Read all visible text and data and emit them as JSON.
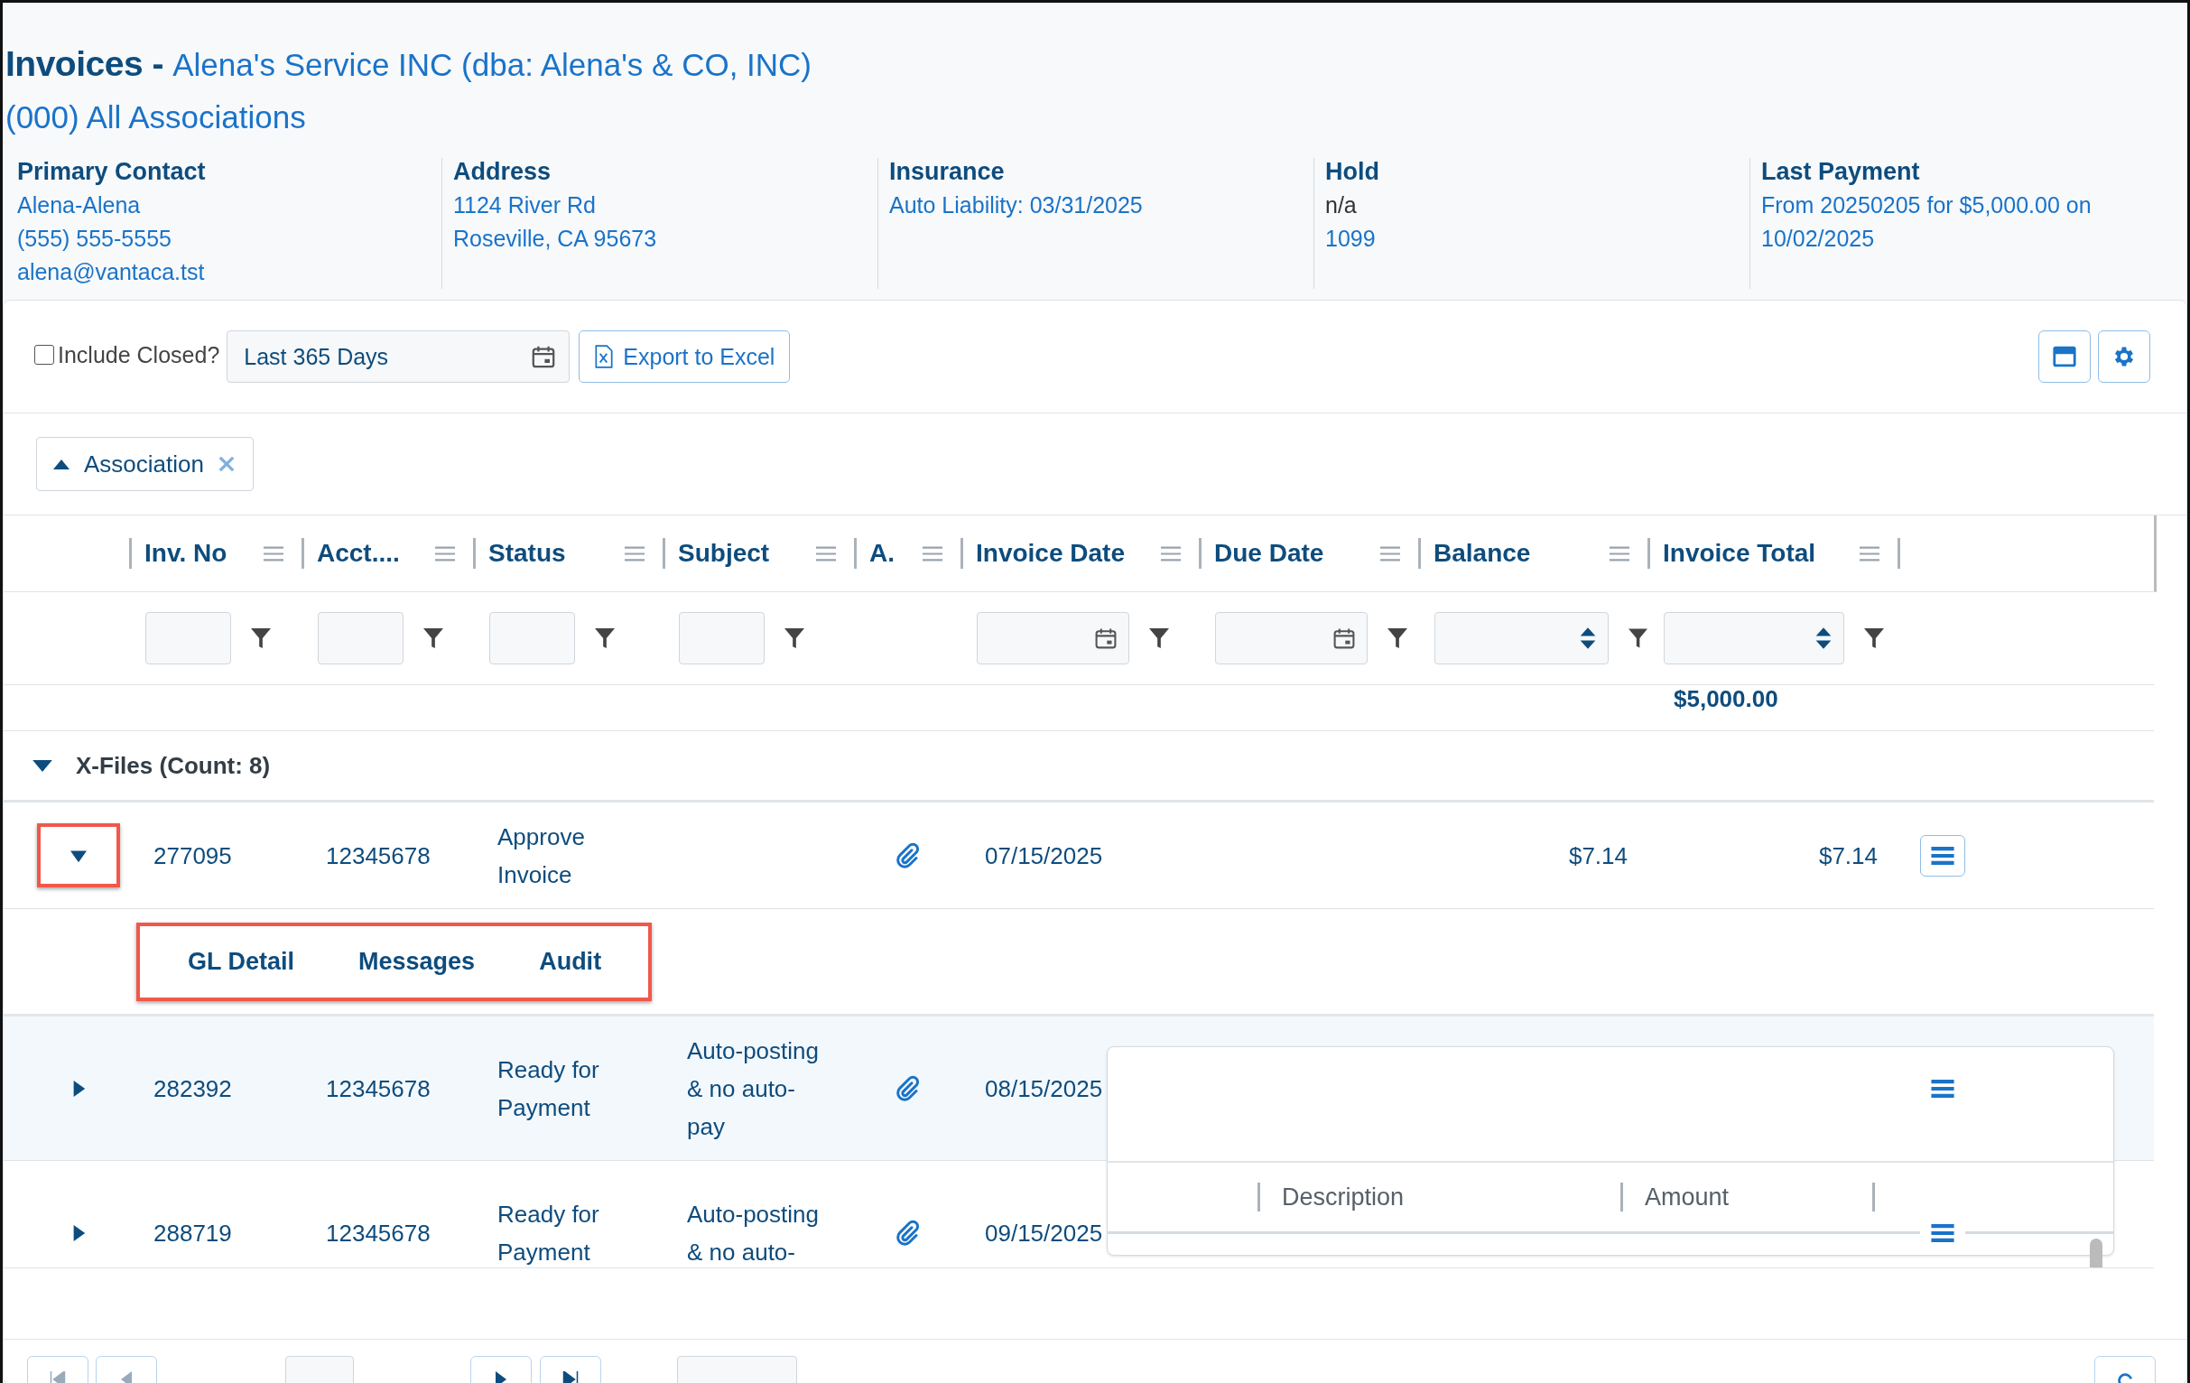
{
  "page": {
    "title": "Invoices - ",
    "vendor": "Alena's Service INC (dba: Alena's & CO, INC)",
    "association": "(000) All Associations"
  },
  "info": [
    {
      "label": "Primary Contact",
      "lines": [
        {
          "text": "Alena-Alena",
          "link": true
        },
        {
          "text": "(555) 555-5555",
          "link": true
        },
        {
          "text": "alena@vantaca.tst",
          "link": true
        }
      ]
    },
    {
      "label": "Address",
      "lines": [
        {
          "text": "1124 River Rd",
          "link": true
        },
        {
          "text": "Roseville, CA 95673",
          "link": true
        }
      ]
    },
    {
      "label": "Insurance",
      "lines": [
        {
          "text": "Auto Liability: 03/31/2025",
          "link": true
        }
      ]
    },
    {
      "label": "Hold",
      "lines": [
        {
          "text": "n/a",
          "link": false
        },
        {
          "text": "1099",
          "link": true
        }
      ]
    },
    {
      "label": "Last Payment",
      "lines": [
        {
          "text": "From 20250205 for $5,000.00 on 10/02/2025",
          "link": true
        }
      ]
    }
  ],
  "toolbar": {
    "include_closed": {
      "label": "Include Closed?",
      "checked": false
    },
    "date_range": "Last 365 Days",
    "export": "Export to Excel"
  },
  "group_chips": [
    {
      "label": "Association"
    }
  ],
  "columns": [
    {
      "label": "Inv. No",
      "kind": "text"
    },
    {
      "label": "Acct....",
      "kind": "text"
    },
    {
      "label": "Status",
      "kind": "text"
    },
    {
      "label": "Subject",
      "kind": "text"
    },
    {
      "label": "A.",
      "kind": "none"
    },
    {
      "label": "Invoice Date",
      "kind": "date"
    },
    {
      "label": "Due Date",
      "kind": "date"
    },
    {
      "label": "Balance",
      "kind": "number"
    },
    {
      "label": "Invoice Total",
      "kind": "number"
    }
  ],
  "summary": {
    "invoice_total": "$5,000.00"
  },
  "group": {
    "label": "X-Files (Count: 8)",
    "expanded": true
  },
  "rows": [
    {
      "inv_no": "277095",
      "account": "12345678",
      "status": "Approve Invoice",
      "attachment": true,
      "invoice_date": "07/15/2025",
      "balance": "$7.14",
      "invoice_total": "$7.14",
      "expanded": true,
      "selected": false
    },
    {
      "inv_no": "282392",
      "account": "12345678",
      "status": "Ready for Payment",
      "subject": "Auto-posting & no auto-pay",
      "attachment": true,
      "invoice_date": "08/15/2025",
      "expanded": false,
      "selected": true
    },
    {
      "inv_no": "288719",
      "account": "12345678",
      "status": "Ready for Payment",
      "subject": "Auto-posting & no auto-",
      "attachment": true,
      "invoice_date": "09/15/2025",
      "expanded": false,
      "selected": false
    }
  ],
  "detail_tabs": [
    {
      "label": "GL Detail"
    },
    {
      "label": "Messages"
    },
    {
      "label": "Audit"
    }
  ],
  "detail_panel": {
    "columns": [
      "Description",
      "Amount"
    ]
  }
}
